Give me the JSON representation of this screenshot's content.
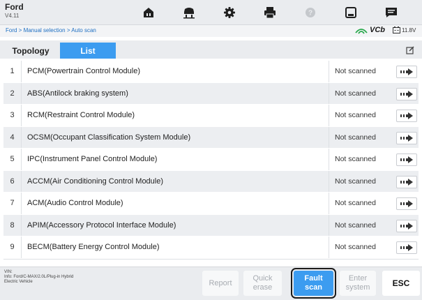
{
  "app": {
    "brand": "Ford",
    "version": "V4.11"
  },
  "toolbar": {
    "icons": [
      "home-icon",
      "vehicle-lift-icon",
      "gear-icon",
      "printer-icon",
      "help-icon",
      "save-icon",
      "message-icon"
    ]
  },
  "breadcrumb": "Ford > Manual selection > Auto scan",
  "status": {
    "vci": "VCb",
    "battery": "11.8V"
  },
  "tabs": [
    {
      "label": "Topology",
      "active": false
    },
    {
      "label": "List",
      "active": true
    }
  ],
  "rows": [
    {
      "num": "1",
      "name": "PCM(Powertrain Control Module)",
      "status": "Not scanned"
    },
    {
      "num": "2",
      "name": "ABS(Antilock braking system)",
      "status": "Not scanned"
    },
    {
      "num": "3",
      "name": "RCM(Restraint Control Module)",
      "status": "Not scanned"
    },
    {
      "num": "4",
      "name": "OCSM(Occupant Classification System Module)",
      "status": "Not scanned"
    },
    {
      "num": "5",
      "name": "IPC(Instrument Panel Control Module)",
      "status": "Not scanned"
    },
    {
      "num": "6",
      "name": "ACCM(Air Conditioning Control Module)",
      "status": "Not scanned"
    },
    {
      "num": "7",
      "name": "ACM(Audio Control Module)",
      "status": "Not scanned"
    },
    {
      "num": "8",
      "name": "APIM(Accessory Protocol Interface Module)",
      "status": "Not scanned"
    },
    {
      "num": "9",
      "name": "BECM(Battery Energy Control Module)",
      "status": "Not scanned"
    }
  ],
  "footer": {
    "vin_label": "VIN:",
    "info": "Info: Ford/C-MAX/2.0L/Plug-in Hybrid Electric Vehicle",
    "buttons": {
      "report": "Report",
      "quick_erase_1": "Quick",
      "quick_erase_2": "erase",
      "fault_scan_1": "Fault",
      "fault_scan_2": "scan",
      "enter_system_1": "Enter",
      "enter_system_2": "system",
      "esc": "ESC"
    }
  },
  "colors": {
    "accent": "#3c9cf0",
    "toolbar_bg": "#eaecef",
    "row_alt": "#eceef1"
  }
}
